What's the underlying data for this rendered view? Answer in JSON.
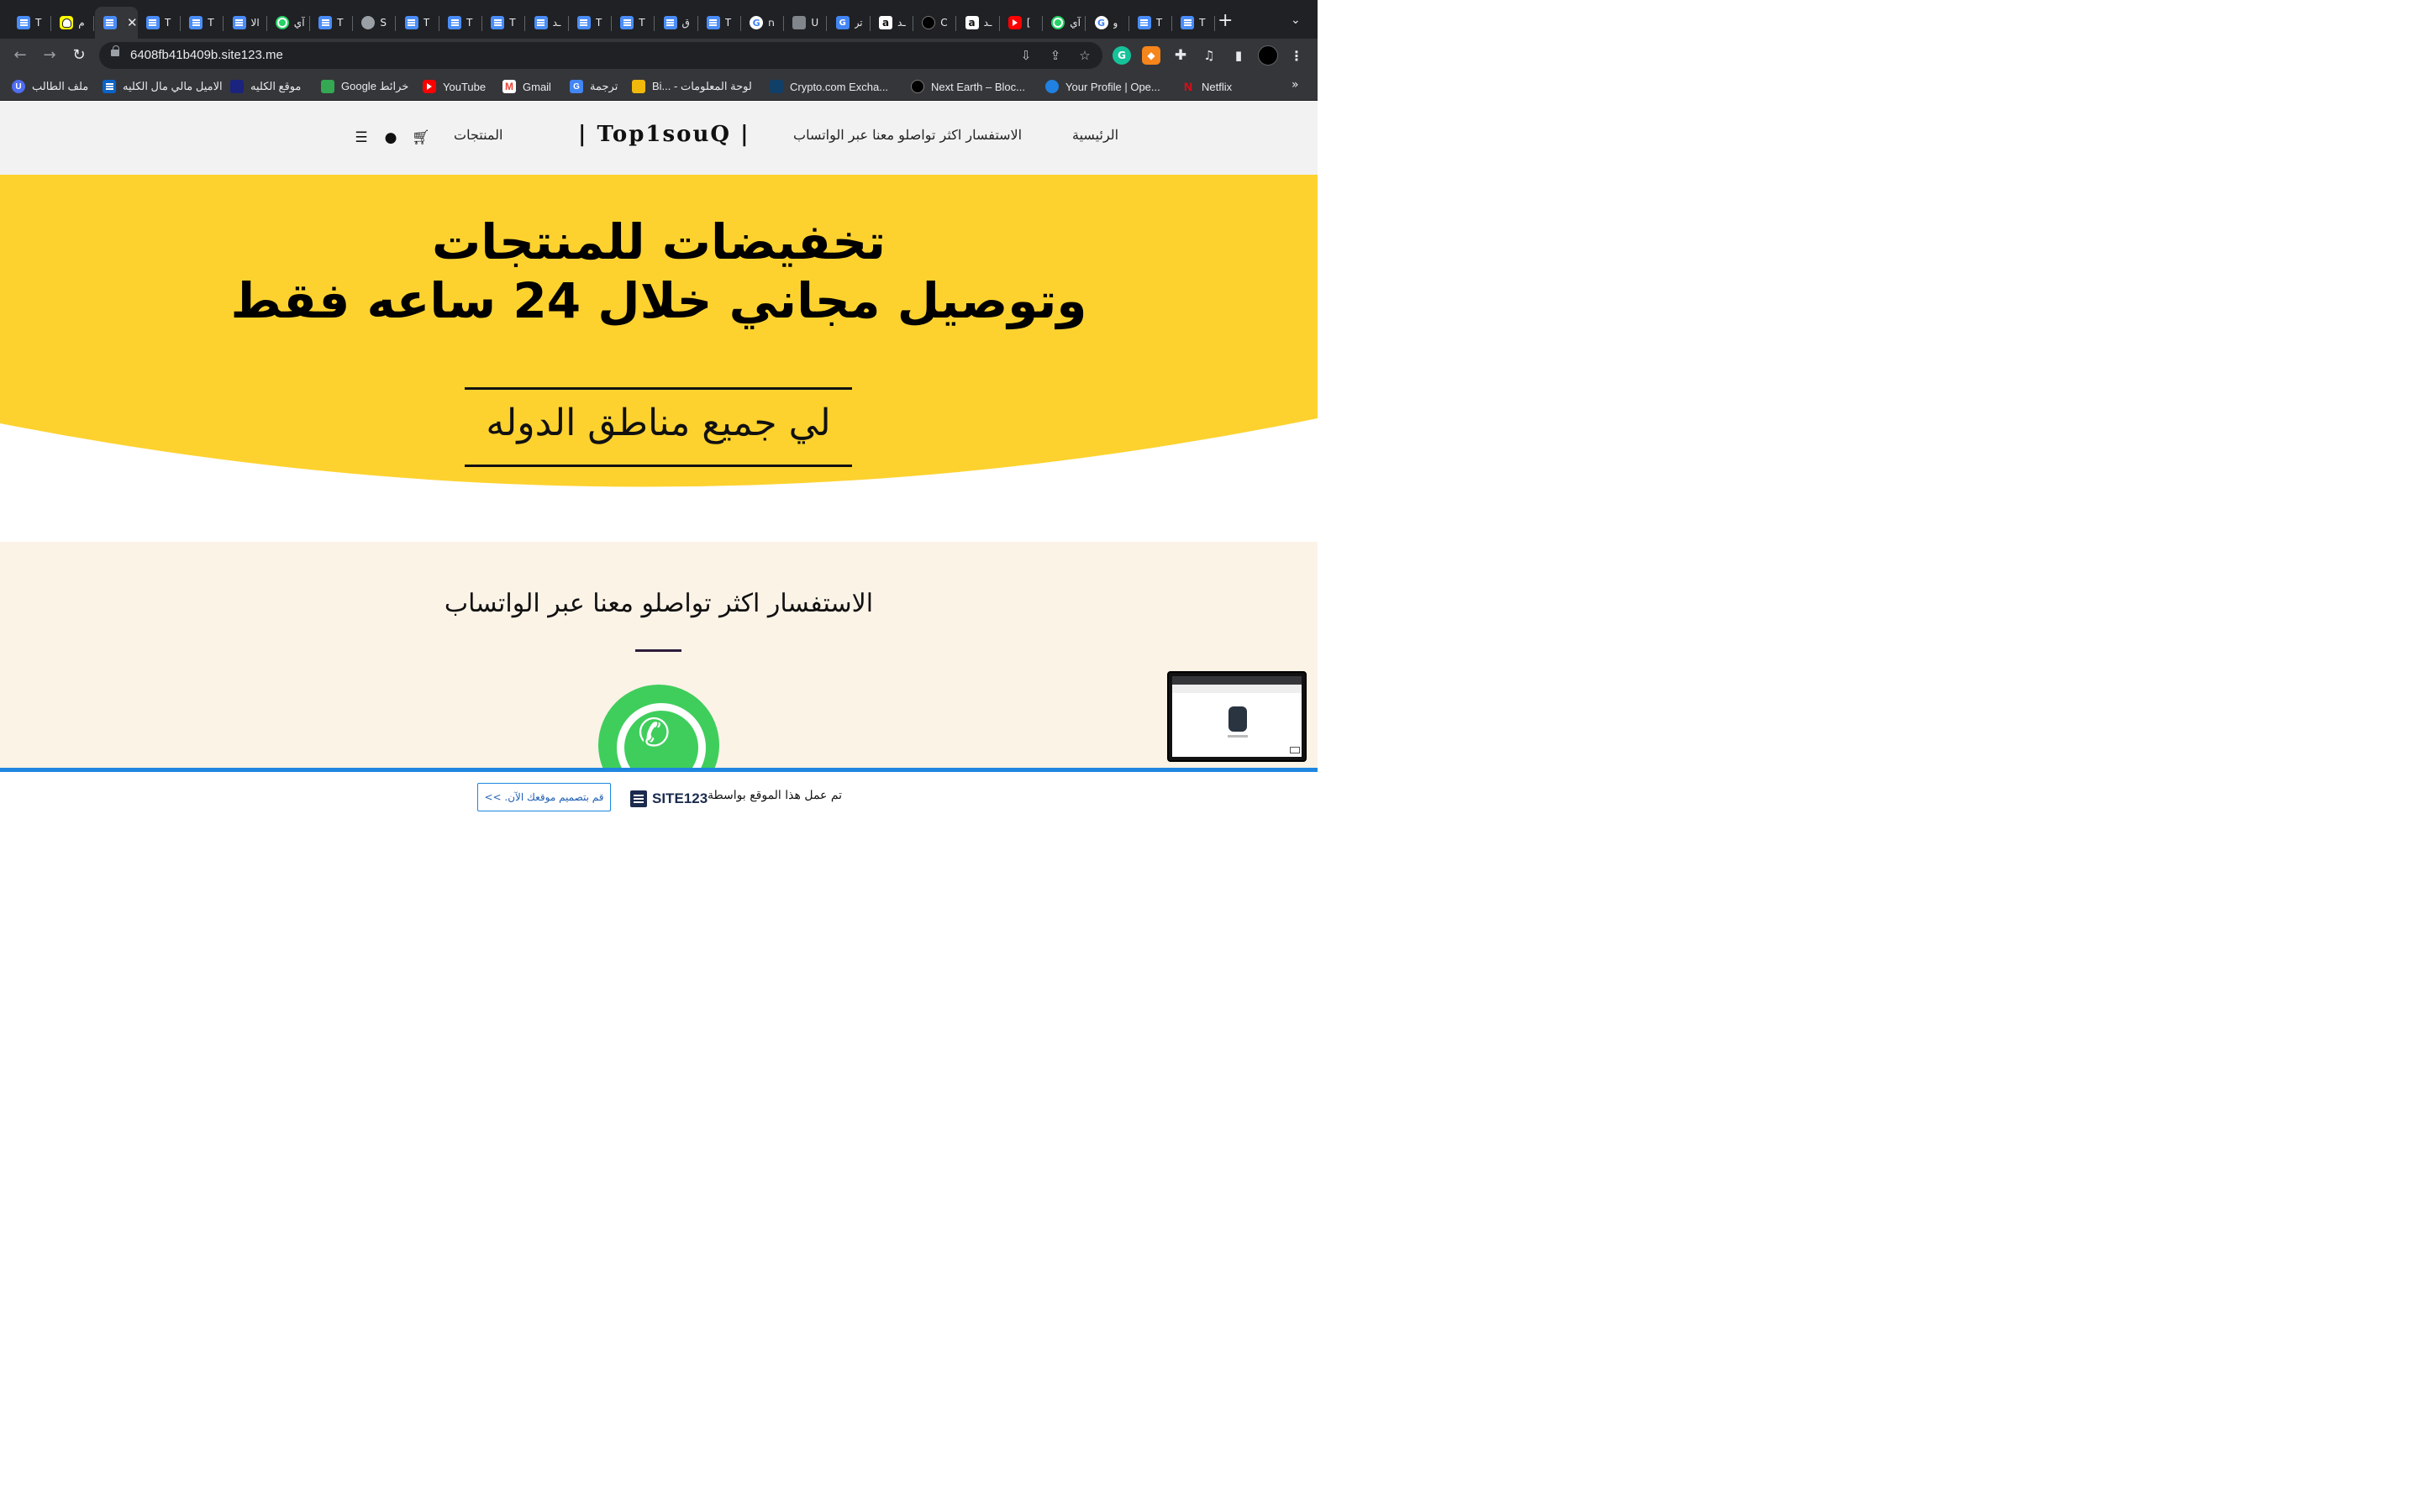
{
  "browser": {
    "tabs": [
      {
        "icon": "doc-icon",
        "title": "T",
        "active": false
      },
      {
        "icon": "snapchat-icon",
        "title": "م",
        "active": false
      },
      {
        "icon": "doc-icon",
        "title": "",
        "active": true
      },
      {
        "icon": "doc-icon",
        "title": "T",
        "active": false
      },
      {
        "icon": "doc-icon",
        "title": "T",
        "active": false
      },
      {
        "icon": "doc-icon",
        "title": "الا",
        "active": false
      },
      {
        "icon": "whatsapp-icon",
        "title": "آي",
        "active": false
      },
      {
        "icon": "doc-icon",
        "title": "T",
        "active": false
      },
      {
        "icon": "globe-icon",
        "title": "S",
        "active": false
      },
      {
        "icon": "doc-icon",
        "title": "T",
        "active": false
      },
      {
        "icon": "doc-icon",
        "title": "T",
        "active": false
      },
      {
        "icon": "doc-icon",
        "title": "T",
        "active": false
      },
      {
        "icon": "doc-icon",
        "title": "ـد",
        "active": false
      },
      {
        "icon": "doc-icon",
        "title": "T",
        "active": false
      },
      {
        "icon": "doc-icon",
        "title": "T",
        "active": false
      },
      {
        "icon": "doc-icon",
        "title": "ق",
        "active": false
      },
      {
        "icon": "doc-icon",
        "title": "T",
        "active": false
      },
      {
        "icon": "google-icon",
        "title": "ח",
        "active": false
      },
      {
        "icon": "layers-icon",
        "title": "U",
        "active": false
      },
      {
        "icon": "translate-icon",
        "title": "تر",
        "active": false
      },
      {
        "icon": "amazon-icon",
        "title": "ـد",
        "active": false
      },
      {
        "icon": "dark-circle-icon",
        "title": "C",
        "active": false
      },
      {
        "icon": "amazon-icon",
        "title": "ـد",
        "active": false
      },
      {
        "icon": "youtube-icon",
        "title": "[",
        "active": false
      },
      {
        "icon": "whatsapp-icon",
        "title": "آي",
        "active": false
      },
      {
        "icon": "google-icon",
        "title": "و",
        "active": false
      },
      {
        "icon": "doc-icon",
        "title": "T",
        "active": false
      },
      {
        "icon": "doc-icon",
        "title": "T",
        "active": false
      }
    ],
    "active_close": "✕",
    "new_tab": "+",
    "tab_menu": "⌄",
    "url": "6408fb41b409b.site123.me",
    "bookmarks": [
      {
        "icon": "student-icon",
        "label": "ملف الطالب"
      },
      {
        "icon": "outlook-icon",
        "label": "الاميل مالي مال الكليه"
      },
      {
        "icon": "college-icon",
        "label": "موقع الكليه"
      },
      {
        "icon": "maps-icon",
        "label": "Google خرائط"
      },
      {
        "icon": "youtube-icon",
        "label": "YouTube"
      },
      {
        "icon": "gmail-icon",
        "label": "Gmail"
      },
      {
        "icon": "translate-icon",
        "label": "ترجمة"
      },
      {
        "icon": "binance-icon",
        "label": "Bi... - لوحة المعلومات"
      },
      {
        "icon": "crypto-icon",
        "label": "Crypto.com Excha..."
      },
      {
        "icon": "nextearth-icon",
        "label": "Next Earth – Bloc..."
      },
      {
        "icon": "opensea-icon",
        "label": "Your Profile | Ope..."
      },
      {
        "icon": "netflix-icon",
        "label": "Netflix"
      }
    ],
    "bookmarks_more": "»"
  },
  "site": {
    "nav": {
      "home": "الرئيسية",
      "contact": "الاستفسار اكثر تواصلو معنا عبر الواتساب",
      "logo": "| Top1souQ |",
      "products": "المنتجات"
    },
    "hero": {
      "line1": "تخفيضات للمنتجات",
      "line2": "وتوصيل مجاني خلال 24 ساعه فقط",
      "boxed": "لي جميع مناطق الدوله",
      "color": "#fdd22f"
    },
    "contact": {
      "title": "الاستفسار اكثر تواصلو معنا عبر الواتساب",
      "background": "#fcf3e7"
    },
    "footer": {
      "made_by": "تم عمل هذا الموقع بواسطة",
      "brand": "SITE123",
      "cta": "قم بتصميم موقعك الآن. >>",
      "accent": "#1f86e0"
    }
  }
}
